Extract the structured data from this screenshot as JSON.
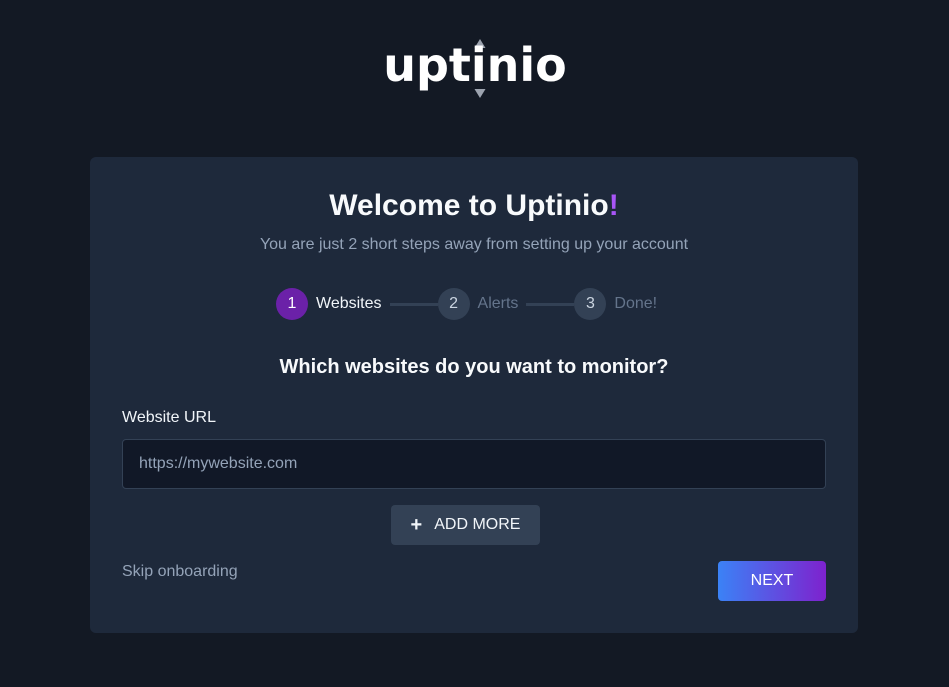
{
  "brand": {
    "logo_text": "uptinio",
    "accent_color": "#a855f7"
  },
  "header": {
    "title": "Welcome to Uptinio",
    "title_suffix": "!",
    "subtitle": "You are just 2 short steps away from setting up your account"
  },
  "steps": [
    {
      "number": "1",
      "label": "Websites",
      "active": true
    },
    {
      "number": "2",
      "label": "Alerts",
      "active": false
    },
    {
      "number": "3",
      "label": "Done!",
      "active": false
    }
  ],
  "form": {
    "question": "Which websites do you want to monitor?",
    "url_label": "Website URL",
    "url_value": "",
    "url_placeholder": "https://mywebsite.com",
    "add_more_icon": "plus-icon",
    "add_more_label": "ADD MORE"
  },
  "footer": {
    "skip_label": "Skip onboarding",
    "next_label": "NEXT",
    "next_gradient": [
      "#3b82f6",
      "#7e22ce"
    ]
  }
}
